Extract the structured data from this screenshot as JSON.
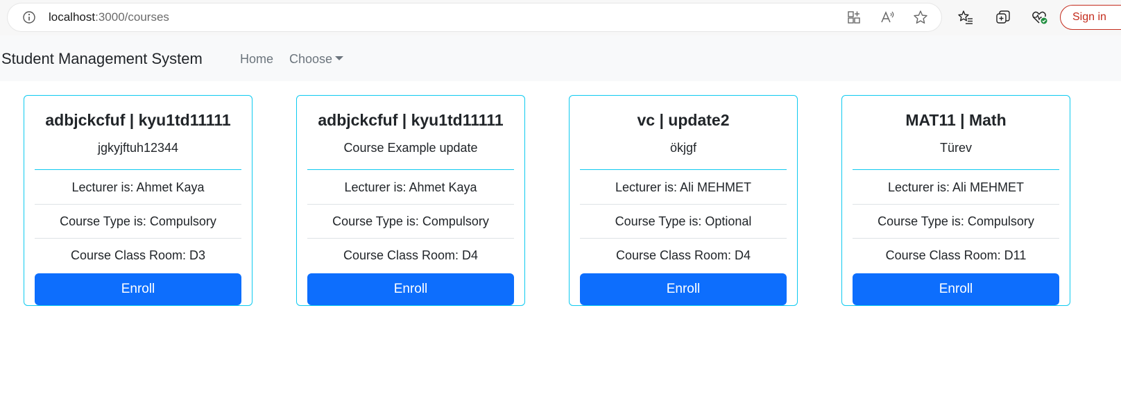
{
  "browser": {
    "url_host": "localhost",
    "url_path": ":3000/courses",
    "signin_label": "Sign in"
  },
  "navbar": {
    "brand": "Student Management System",
    "links": [
      {
        "label": "Home"
      },
      {
        "label": "Choose"
      }
    ]
  },
  "courses": [
    {
      "title": "adbjckcfuf | kyu1td11111",
      "description": "jgkyjftuh12344",
      "lecturer": "Lecturer is: Ahmet Kaya",
      "course_type": "Course Type is: Compulsory",
      "class_room": "Course Class Room: D3",
      "button_label": "Enroll"
    },
    {
      "title": "adbjckcfuf | kyu1td11111",
      "description": "Course Example update",
      "lecturer": "Lecturer is: Ahmet Kaya",
      "course_type": "Course Type is: Compulsory",
      "class_room": "Course Class Room: D4",
      "button_label": "Enroll"
    },
    {
      "title": "vc | update2",
      "description": "ökjgf",
      "lecturer": "Lecturer is: Ali MEHMET",
      "course_type": "Course Type is: Optional",
      "class_room": "Course Class Room: D4",
      "button_label": "Enroll"
    },
    {
      "title": "MAT11 | Math",
      "description": "Türev",
      "lecturer": "Lecturer is: Ali MEHMET",
      "course_type": "Course Type is: Compulsory",
      "class_room": "Course Class Room: D11",
      "button_label": "Enroll"
    }
  ],
  "colors": {
    "card_border": "#0dcaf0",
    "button_primary": "#0d6efd",
    "navbar_bg": "#f8f9fa",
    "signin_accent": "#c42b1c"
  },
  "icons": {
    "address_bar": [
      "info-icon"
    ],
    "toolbar": [
      "app-available-icon",
      "read-aloud-icon",
      "favorite-star-icon",
      "favorites-list-icon",
      "collections-icon",
      "browser-essentials-icon"
    ]
  }
}
